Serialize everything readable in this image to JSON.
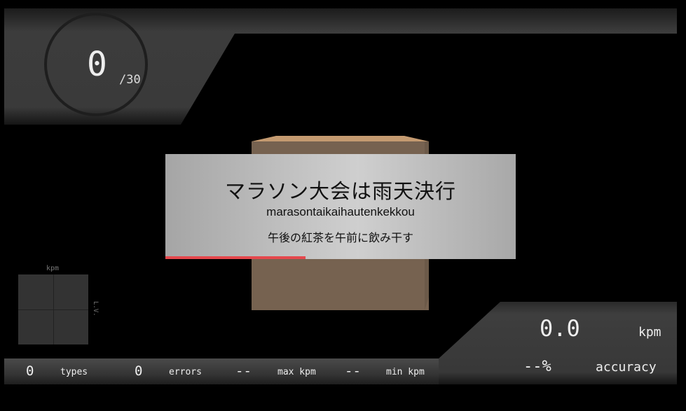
{
  "counter": {
    "value": "0",
    "total": "/30"
  },
  "word": {
    "japanese": "マラソン大会は雨天決行",
    "romaji": "marasontaikaihautenkekkou",
    "next": "午後の紅茶を午前に飲み干す",
    "progress": 0.4
  },
  "graph": {
    "top_label": "kpm",
    "side_label": "L.V."
  },
  "speed": {
    "value": "0.0",
    "unit": "kpm"
  },
  "accuracy": {
    "value": "--%",
    "label": "accuracy"
  },
  "stats": {
    "types_value": "0",
    "types_label": "types",
    "errors_value": "0",
    "errors_label": "errors",
    "max_value": "--",
    "max_label": "max kpm",
    "min_value": "--",
    "min_label": "min kpm"
  },
  "colors": {
    "progress": "#e5484d",
    "box": "#766250",
    "panel": "#3c3c3c"
  }
}
